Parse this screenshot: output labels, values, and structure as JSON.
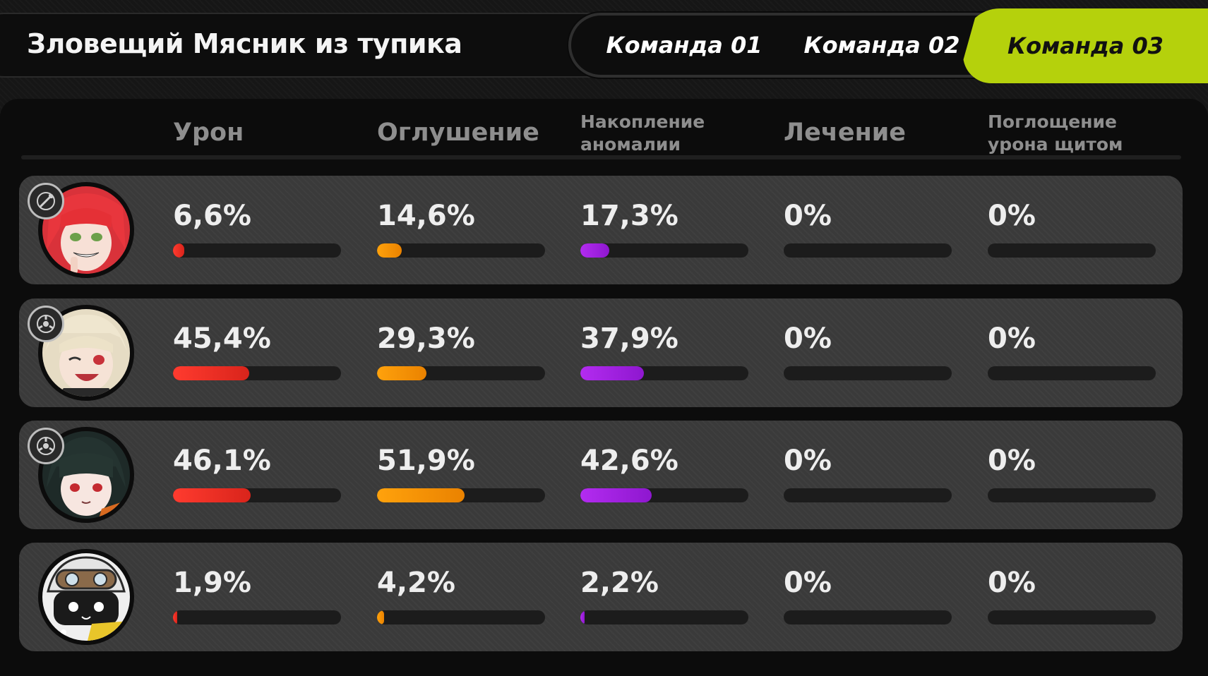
{
  "header": {
    "title": "Зловещий Мясник из тупика"
  },
  "tabs": [
    {
      "label": "Команда 01",
      "active": false
    },
    {
      "label": "Команда 02",
      "active": false
    },
    {
      "label": "Команда 03",
      "active": true
    }
  ],
  "columns": {
    "damage": "Урон",
    "daze": "Оглушение",
    "anomaly_line1": "Накопление",
    "anomaly_line2": "аномалии",
    "healing": "Лечение",
    "shield_line1": "Поглощение",
    "shield_line2": "урона щитом"
  },
  "colors": {
    "accent": "#b5d10c",
    "damage": "#e8291e",
    "daze": "#f59a0a",
    "anomaly": "#a020e0"
  },
  "rows": [
    {
      "avatar_icon": "red-hair-agent-portrait-icon",
      "badge_icon": "attack-specialty-icon",
      "damage": {
        "label": "6,6%",
        "value": 6.6
      },
      "daze": {
        "label": "14,6%",
        "value": 14.6
      },
      "anomaly": {
        "label": "17,3%",
        "value": 17.3
      },
      "healing": {
        "label": "0%",
        "value": 0
      },
      "shield": {
        "label": "0%",
        "value": 0
      }
    },
    {
      "avatar_icon": "blonde-agent-portrait-icon",
      "badge_icon": "stun-specialty-icon",
      "damage": {
        "label": "45,4%",
        "value": 45.4
      },
      "daze": {
        "label": "29,3%",
        "value": 29.3
      },
      "anomaly": {
        "label": "37,9%",
        "value": 37.9
      },
      "healing": {
        "label": "0%",
        "value": 0
      },
      "shield": {
        "label": "0%",
        "value": 0
      }
    },
    {
      "avatar_icon": "dark-hair-agent-portrait-icon",
      "badge_icon": "stun-specialty-icon",
      "damage": {
        "label": "46,1%",
        "value": 46.1
      },
      "daze": {
        "label": "51,9%",
        "value": 51.9
      },
      "anomaly": {
        "label": "42,6%",
        "value": 42.6
      },
      "healing": {
        "label": "0%",
        "value": 0
      },
      "shield": {
        "label": "0%",
        "value": 0
      }
    },
    {
      "avatar_icon": "bangboo-portrait-icon",
      "badge_icon": "",
      "damage": {
        "label": "1,9%",
        "value": 1.9
      },
      "daze": {
        "label": "4,2%",
        "value": 4.2
      },
      "anomaly": {
        "label": "2,2%",
        "value": 2.2
      },
      "healing": {
        "label": "0%",
        "value": 0
      },
      "shield": {
        "label": "0%",
        "value": 0
      }
    }
  ]
}
